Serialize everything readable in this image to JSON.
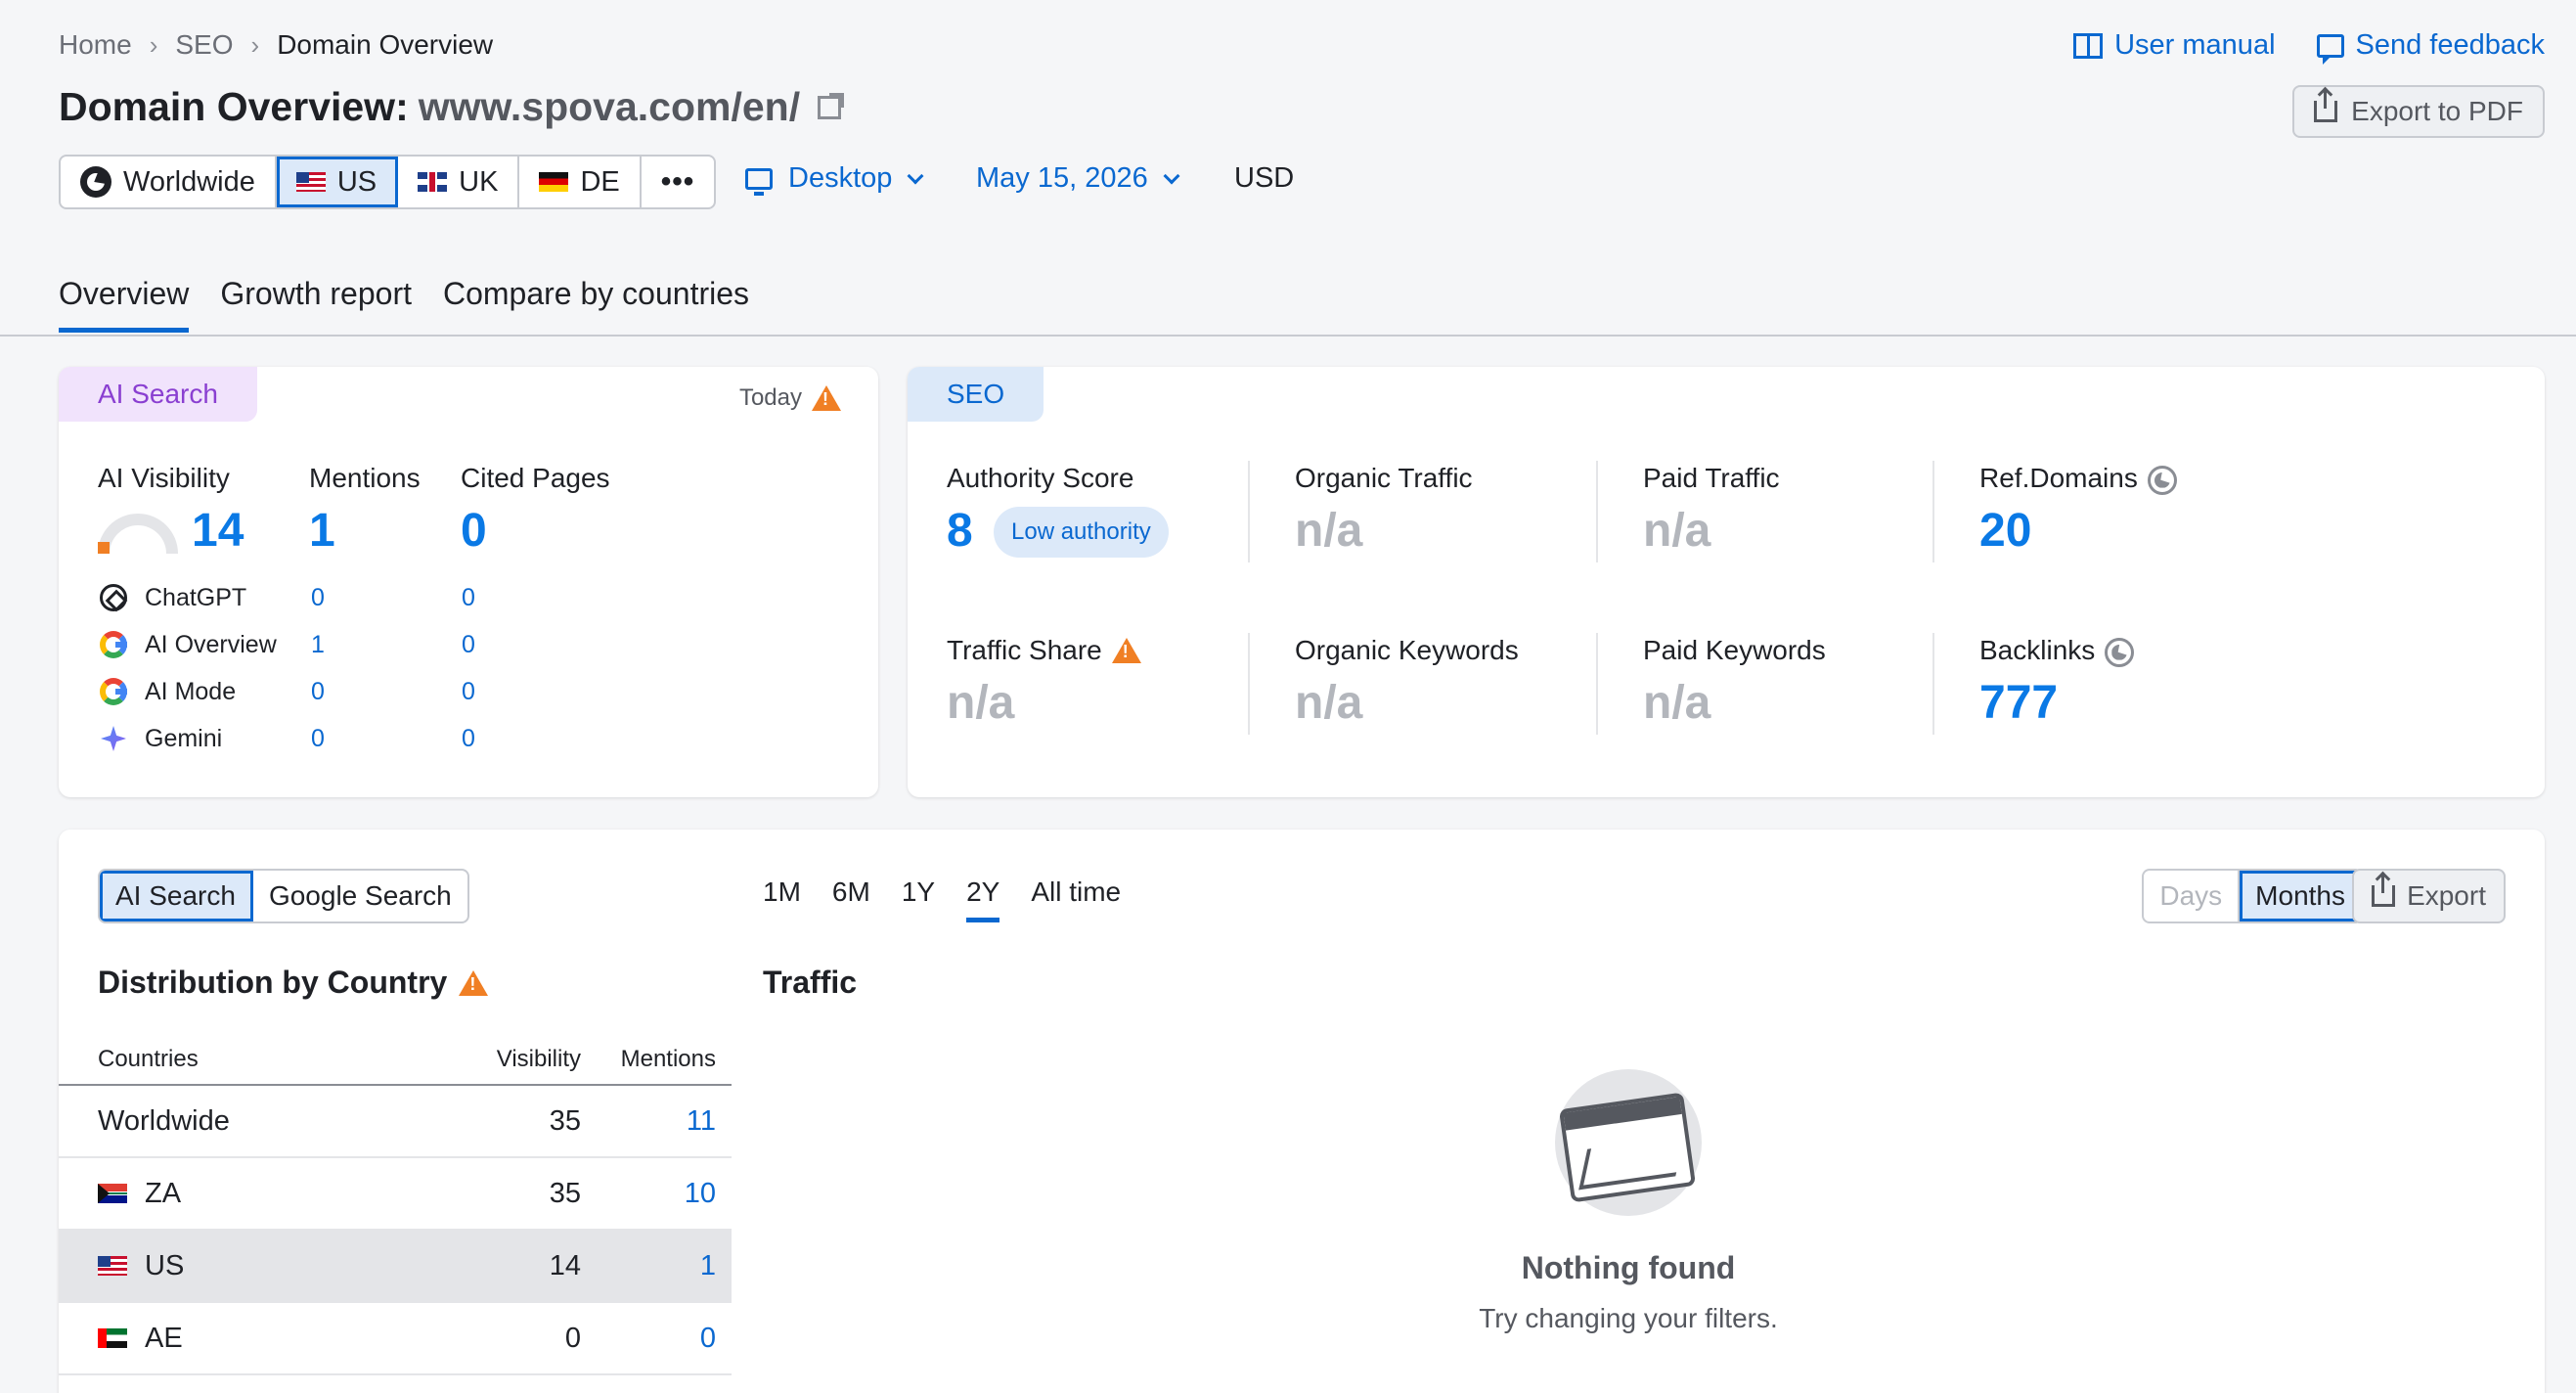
{
  "breadcrumb": [
    "Home",
    "SEO",
    "Domain Overview"
  ],
  "top_links": {
    "manual": "User manual",
    "feedback": "Send feedback"
  },
  "title": {
    "prefix": "Domain Overview:",
    "domain": "www.spova.com/en/"
  },
  "export_pdf": "Export to PDF",
  "countries": {
    "worldwide": "Worldwide",
    "us": "US",
    "uk": "UK",
    "de": "DE",
    "more": "•••"
  },
  "device": "Desktop",
  "date": "May 15, 2026",
  "currency": "USD",
  "tabs": [
    "Overview",
    "Growth report",
    "Compare by countries"
  ],
  "ai_card": {
    "tag": "AI Search",
    "today": "Today",
    "visibility_label": "AI Visibility",
    "visibility_value": "14",
    "visibility_gauge_fraction": 0.14,
    "mentions_label": "Mentions",
    "mentions_value": "1",
    "cited_label": "Cited Pages",
    "cited_value": "0",
    "rows": [
      {
        "name": "ChatGPT",
        "icon": "chatgpt-icon",
        "mentions": "0",
        "cited": "0"
      },
      {
        "name": "AI Overview",
        "icon": "google-icon",
        "mentions": "1",
        "cited": "0"
      },
      {
        "name": "AI Mode",
        "icon": "google-icon",
        "mentions": "0",
        "cited": "0"
      },
      {
        "name": "Gemini",
        "icon": "gemini-icon",
        "mentions": "0",
        "cited": "0"
      }
    ]
  },
  "seo_card": {
    "tag": "SEO",
    "authority_label": "Authority Score",
    "authority_value": "8",
    "authority_badge": "Low authority",
    "organic_traffic_label": "Organic Traffic",
    "organic_traffic_value": "n/a",
    "paid_traffic_label": "Paid Traffic",
    "paid_traffic_value": "n/a",
    "ref_domains_label": "Ref.Domains",
    "ref_domains_value": "20",
    "traffic_share_label": "Traffic Share",
    "traffic_share_value": "n/a",
    "organic_keywords_label": "Organic Keywords",
    "organic_keywords_value": "n/a",
    "paid_keywords_label": "Paid Keywords",
    "paid_keywords_value": "n/a",
    "backlinks_label": "Backlinks",
    "backlinks_value": "777"
  },
  "bottom": {
    "source_toggle": [
      "AI Search",
      "Google Search"
    ],
    "periods": [
      "1M",
      "6M",
      "1Y",
      "2Y",
      "All time"
    ],
    "granularity": [
      "Days",
      "Months"
    ],
    "export": "Export",
    "distribution_title": "Distribution by Country",
    "traffic_title": "Traffic",
    "table_headers": {
      "country": "Countries",
      "visibility": "Visibility",
      "mentions": "Mentions"
    },
    "rows": [
      {
        "country": "Worldwide",
        "visibility": "35",
        "mentions": "11"
      },
      {
        "country": "ZA",
        "visibility": "35",
        "mentions": "10"
      },
      {
        "country": "US",
        "visibility": "14",
        "mentions": "1"
      },
      {
        "country": "AE",
        "visibility": "0",
        "mentions": "0"
      }
    ],
    "empty_title": "Nothing found",
    "empty_sub": "Try changing your filters."
  },
  "colors": {
    "accent": "#0a68d0",
    "value_blue": "#0a79e5",
    "ai_tag": "#8a3fd1",
    "warning": "#f07f24"
  }
}
